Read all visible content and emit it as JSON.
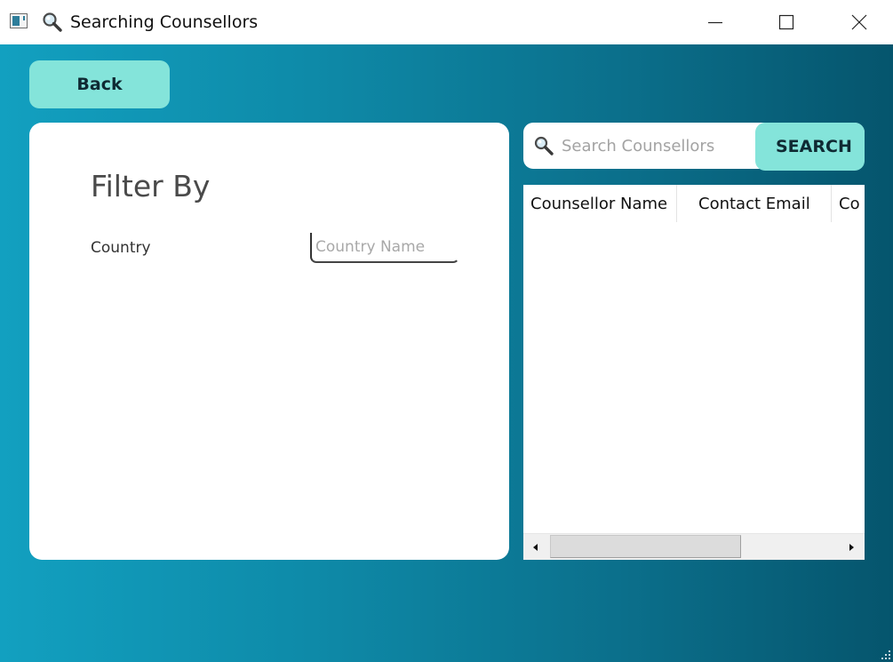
{
  "window": {
    "title": "Searching Counsellors",
    "icon": "app-window-icon"
  },
  "titlebar_controls": {
    "minimize_icon": "minimize-icon",
    "maximize_icon": "maximize-icon",
    "close_icon": "close-icon"
  },
  "toolbar": {
    "back_label": "Back"
  },
  "filter": {
    "heading": "Filter By",
    "country_label": "Country",
    "country_value": "",
    "country_placeholder": "Country Name"
  },
  "search": {
    "icon": "magnifier-icon",
    "value": "",
    "placeholder": "Search Counsellors",
    "button_label": "SEARCH"
  },
  "table": {
    "columns": [
      "Counsellor Name",
      "Contact Email",
      "Co"
    ],
    "rows": []
  },
  "colors": {
    "accent": "#84e4da",
    "gradient_start": "#12a0c0",
    "gradient_end": "#05556d",
    "panel": "#ffffff"
  }
}
